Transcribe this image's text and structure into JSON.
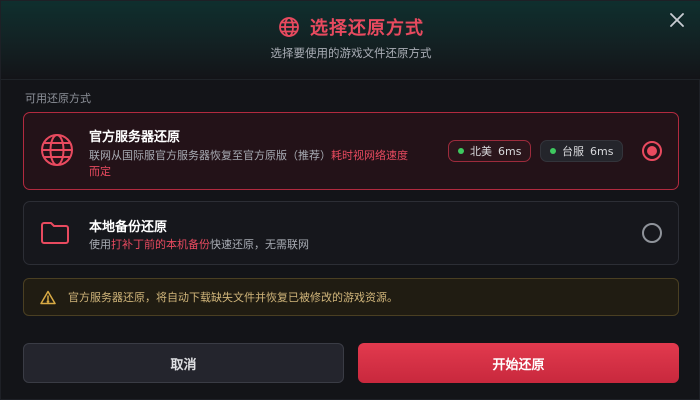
{
  "header": {
    "title": "选择还原方式",
    "subtitle": "选择要使用的游戏文件还原方式",
    "title_icon": "globe-icon",
    "close_icon": "close-icon"
  },
  "section_label": "可用还原方式",
  "options": [
    {
      "icon": "globe-icon",
      "title": "官方服务器还原",
      "desc_prefix": "联网从国际服官方服务器恢复至官方原版（推荐）",
      "desc_highlight": "耗时视网络速度而定",
      "selected": true,
      "servers": [
        {
          "name": "北美",
          "latency": "6ms",
          "active": true
        },
        {
          "name": "台服",
          "latency": "6ms",
          "active": false
        }
      ]
    },
    {
      "icon": "folder-icon",
      "title": "本地备份还原",
      "desc_prefix": "使用",
      "desc_highlight": "打补丁前的本机备份",
      "desc_suffix": "快速还原，无需联网",
      "selected": false
    }
  ],
  "warning": {
    "icon": "warning-icon",
    "text": "官方服务器还原，将自动下载缺失文件并恢复已被修改的游戏资源。"
  },
  "buttons": {
    "cancel": "取消",
    "start": "开始还原"
  },
  "colors": {
    "accent": "#e84a5f",
    "online_dot": "#3ec95f",
    "warning_text": "#d0b57a"
  }
}
